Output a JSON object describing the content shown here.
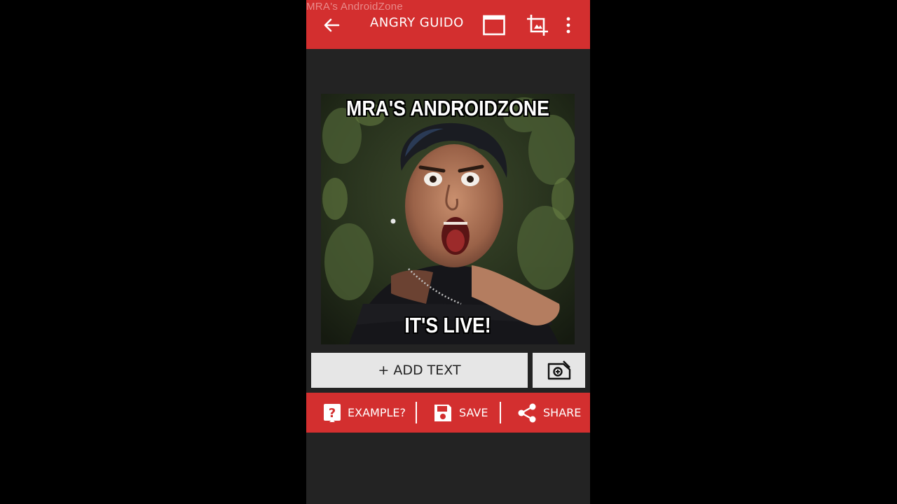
{
  "watermark": "MRA's  AndroidZone",
  "appbar": {
    "title": "ANGRY GUIDO",
    "back_icon": "arrow-left-icon",
    "ratio_icon": "aspect-ratio-icon",
    "crop_icon": "crop-icon",
    "more_icon": "more-vert-icon"
  },
  "meme": {
    "top_text": "MRA'S  ANDROIDZONE",
    "bottom_text": "IT'S LIVE!"
  },
  "controls": {
    "add_text_label": "+ ADD TEXT",
    "add_image_icon": "add-image-icon"
  },
  "actions": {
    "example_label": "EXAMPLE?",
    "save_label": "SAVE",
    "share_label": "SHARE"
  },
  "colors": {
    "accent": "#d32f2f",
    "background": "#232323"
  }
}
